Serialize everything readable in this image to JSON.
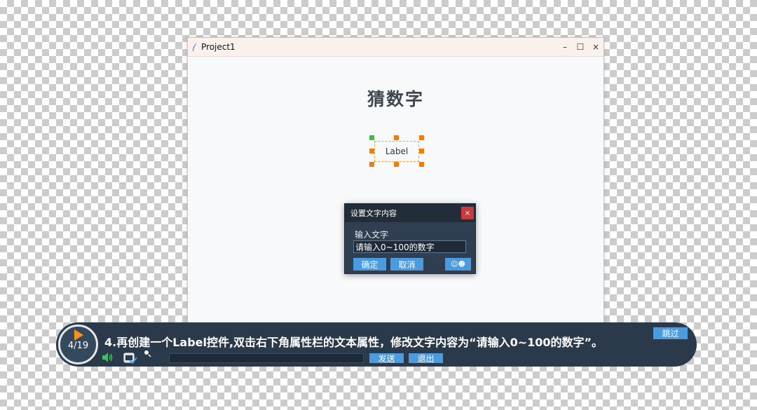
{
  "window": {
    "title": "Project1",
    "controls": {
      "minimize": "–",
      "maximize": "☐",
      "close": "×"
    }
  },
  "canvas": {
    "heading": "猜数字",
    "selected_label_text": "Label"
  },
  "dialog": {
    "title": "设置文字内容",
    "close": "×",
    "field_label": "输入文字",
    "input_value": "请输入0~100的数字",
    "ok_button": "确定",
    "cancel_button": "取消",
    "emoji_button": "☺☻"
  },
  "tutorial": {
    "step": "4/19",
    "instruction": "4.再创建一个Label控件,双击右下角属性栏的文本属性，修改文字内容为“请输入0~100的数字”。",
    "send_button": "发送",
    "exit_button": "退出",
    "skip_button": "跳过"
  },
  "colors": {
    "accent": "#4a9be0",
    "handle": "#f57c00",
    "handle_origin": "#27c93f",
    "close_red": "#c73a3f",
    "tutorial_bg": "#2b3a4b"
  },
  "icons": [
    "app-feather-icon",
    "play-icon",
    "speaker-icon",
    "recorder-icon",
    "pointer-icon"
  ]
}
